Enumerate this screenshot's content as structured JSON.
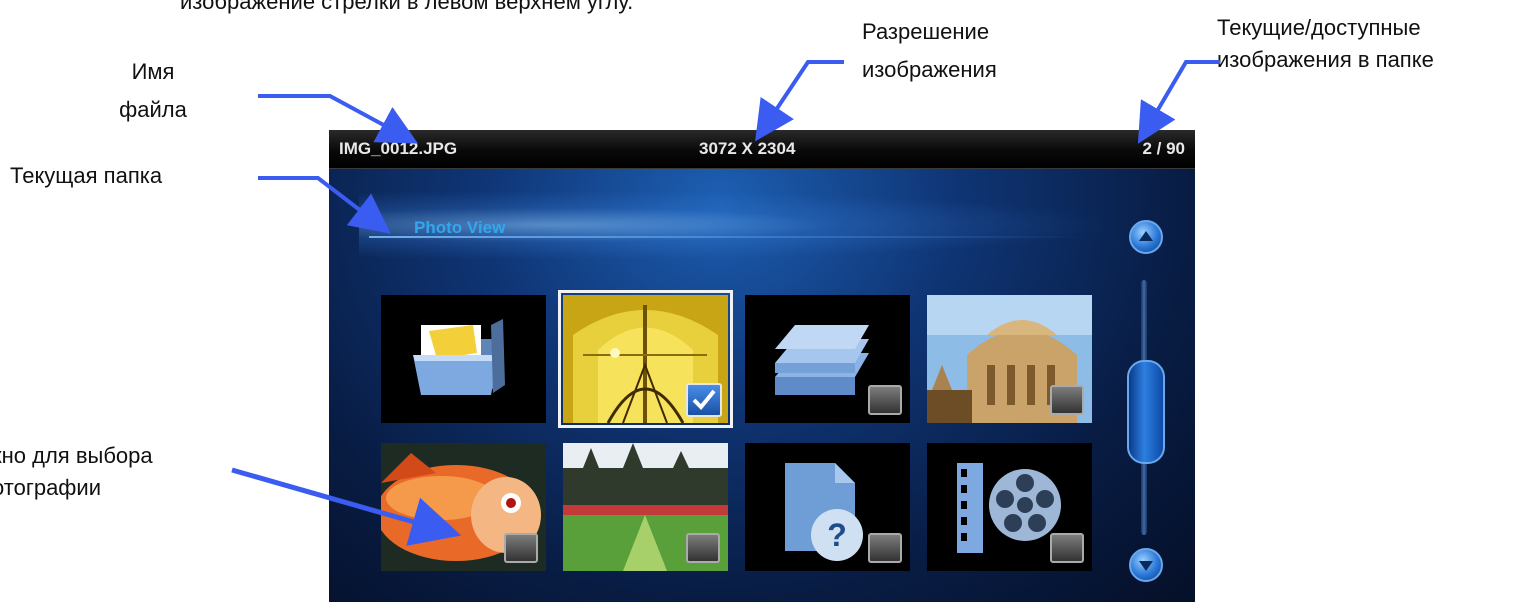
{
  "annotations": {
    "top_caption": "изображение стрелки в левом верхнем углу.",
    "filename_label_line1": "Имя",
    "filename_label_line2": "файла",
    "resolution_label_line1": "Разрешение",
    "resolution_label_line2": "изображения",
    "count_label_line1": "Текущие/доступные",
    "count_label_line2": "изображения в папке",
    "folder_label": "Текущая папка",
    "selection_label_line1": "кно для выбора",
    "selection_label_line2": "отографии"
  },
  "screen": {
    "file_name": "IMG_0012.JPG",
    "resolution": "3072 X 2304",
    "counter": "2 / 90",
    "folder_title": "Photo View"
  },
  "thumbnails": [
    {
      "icon": "folder-icon",
      "selected": false
    },
    {
      "icon": "photo-cathedral",
      "selected": true
    },
    {
      "icon": "stacked-folders-icon",
      "selected": false
    },
    {
      "icon": "photo-building",
      "selected": false
    },
    {
      "icon": "photo-fish",
      "selected": false
    },
    {
      "icon": "photo-castle",
      "selected": false
    },
    {
      "icon": "unknown-file-icon",
      "selected": false
    },
    {
      "icon": "video-reel-icon",
      "selected": false
    }
  ],
  "colors": {
    "arrow": "#3a5cf0",
    "folder_title": "#31a8ee",
    "accent_blue": "#2a77d6"
  }
}
